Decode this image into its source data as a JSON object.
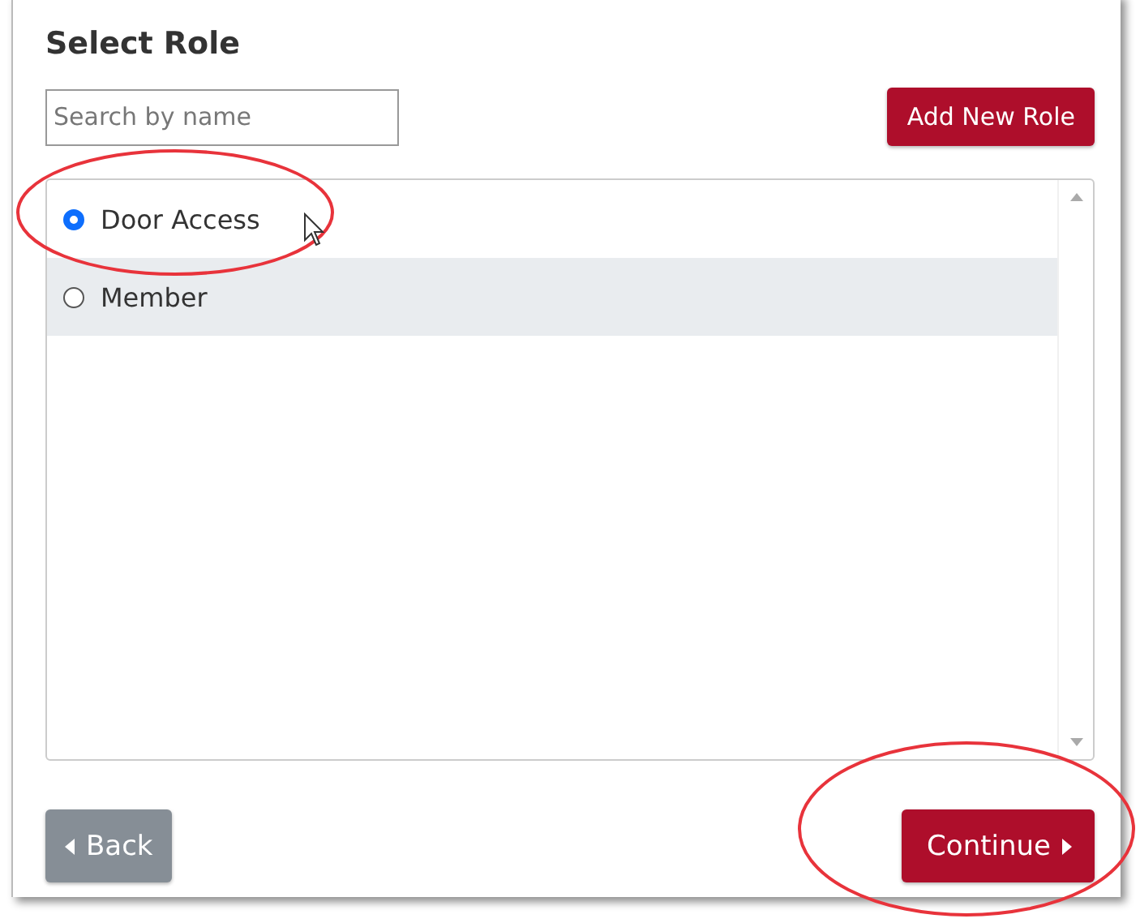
{
  "title": "Select Role",
  "search": {
    "placeholder": "Search by name"
  },
  "add_button": "Add New Role",
  "roles": [
    {
      "label": "Door Access",
      "selected": true,
      "highlighted": false
    },
    {
      "label": "Member",
      "selected": false,
      "highlighted": true
    }
  ],
  "back_button": "Back",
  "continue_button": "Continue"
}
